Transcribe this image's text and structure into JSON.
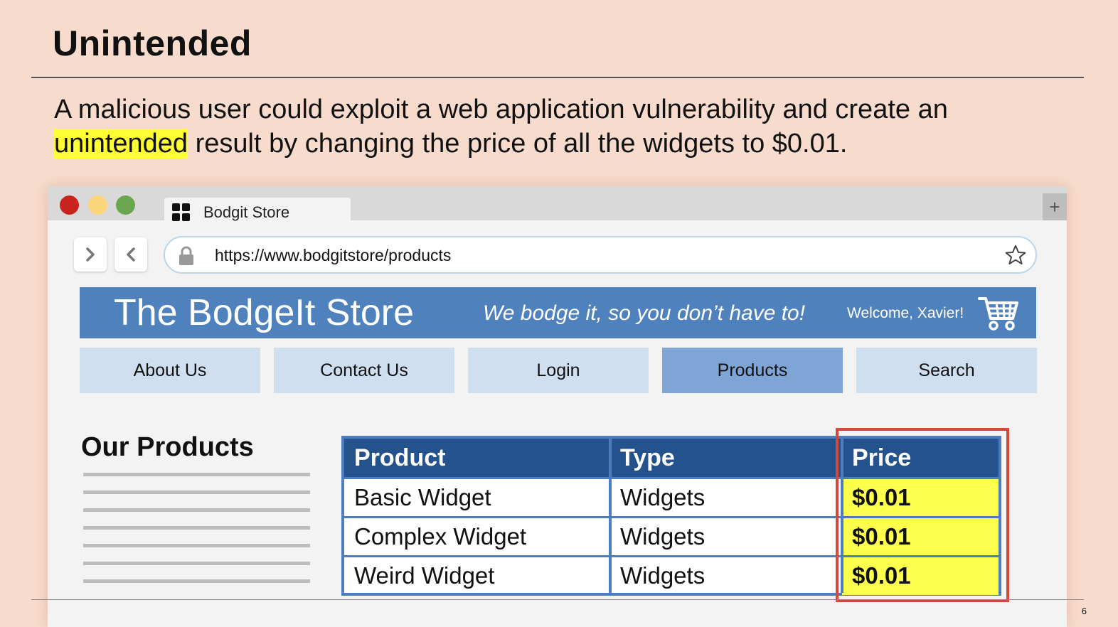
{
  "slide": {
    "title": "Unintended",
    "text_before": "A malicious user could exploit a web application vulnerability and create an ",
    "text_highlight": "unintended",
    "text_after": " result by changing the price of all the widgets to $0.01.",
    "page_number": "6",
    "highlight_color": "#ffff33"
  },
  "browser": {
    "tab_title": "Bodgit Store",
    "new_tab_label": "+",
    "forward_label": ">",
    "back_label": "<",
    "url": "https://www.bodgitstore/products",
    "icons": [
      "apps-icon",
      "forward-icon",
      "back-icon",
      "lock-icon",
      "star-icon"
    ]
  },
  "store": {
    "name": "The BodgeIt Store",
    "tagline": "We bodge it, so you don’t have to!",
    "welcome": "Welcome, Xavier!",
    "header_color": "#4f81bd",
    "nav": [
      {
        "label": "About Us",
        "active": false
      },
      {
        "label": "Contact Us",
        "active": false
      },
      {
        "label": "Login",
        "active": false
      },
      {
        "label": "Products",
        "active": true
      },
      {
        "label": "Search",
        "active": false
      }
    ],
    "products_title": "Our Products"
  },
  "table": {
    "headers": [
      "Product",
      "Type",
      "Price"
    ],
    "rows": [
      [
        "Basic Widget",
        "Widgets",
        "$0.01"
      ],
      [
        "Complex Widget",
        "Widgets",
        "$0.01"
      ],
      [
        "Weird Widget",
        "Widgets",
        "$0.01"
      ]
    ],
    "header_color": "#24528c",
    "price_highlight_color": "#ffff4d",
    "price_box_color": "#d7483c"
  }
}
